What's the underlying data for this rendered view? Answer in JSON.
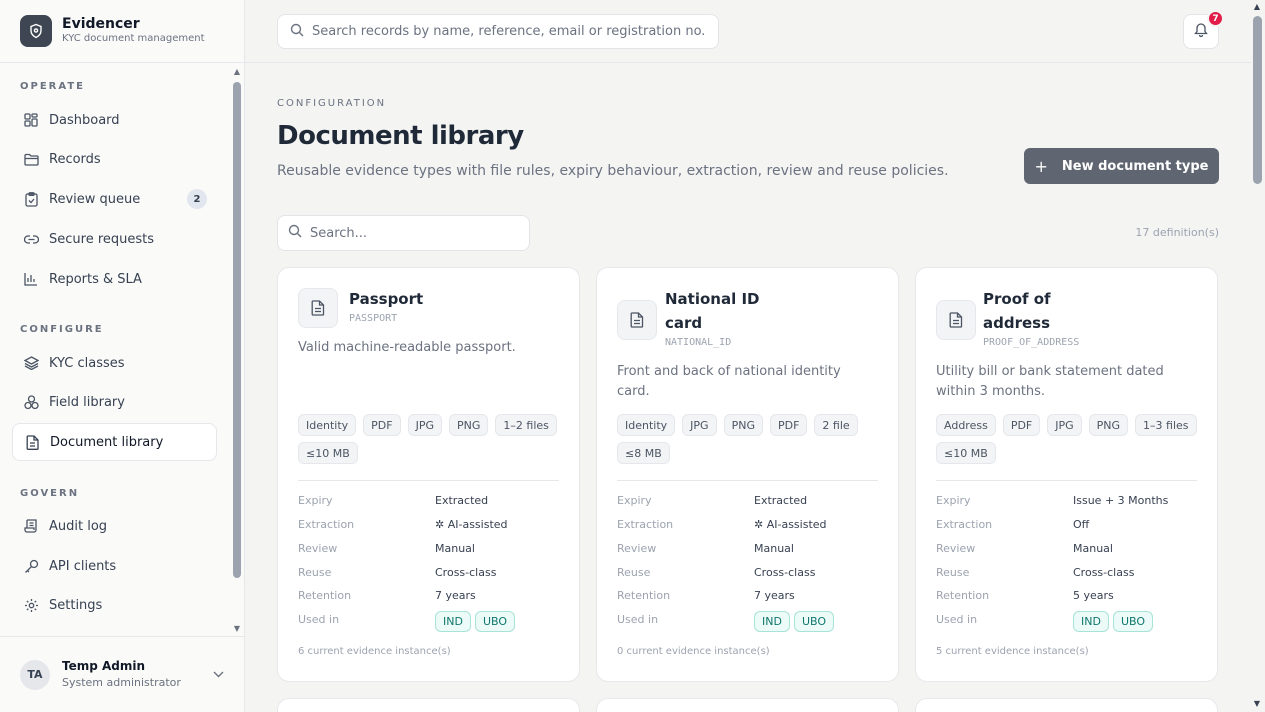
{
  "brand": {
    "name": "Evidencer",
    "subtitle": "KYC document management"
  },
  "sidebar": {
    "sections": [
      "OPERATE",
      "CONFIGURE",
      "GOVERN"
    ],
    "items": [
      {
        "label": "Dashboard",
        "icon": "dashboard-icon"
      },
      {
        "label": "Records",
        "icon": "folder-icon"
      },
      {
        "label": "Review queue",
        "icon": "clipboard-icon",
        "badge": "2"
      },
      {
        "label": "Secure requests",
        "icon": "link-icon"
      },
      {
        "label": "Reports & SLA",
        "icon": "bar-chart-icon"
      },
      {
        "label": "KYC classes",
        "icon": "layers-icon"
      },
      {
        "label": "Field library",
        "icon": "shapes-icon"
      },
      {
        "label": "Document library",
        "icon": "document-icon",
        "active": true
      },
      {
        "label": "Audit log",
        "icon": "scroll-icon"
      },
      {
        "label": "API clients",
        "icon": "key-icon"
      },
      {
        "label": "Settings",
        "icon": "gear-icon"
      }
    ]
  },
  "user": {
    "initials": "TA",
    "name": "Temp Admin",
    "role": "System administrator"
  },
  "topbar": {
    "search_placeholder": "Search records by name, reference, email or registration no.",
    "notifications": "7"
  },
  "page": {
    "eyebrow": "CONFIGURATION",
    "title": "Document library",
    "subtitle": "Reusable evidence types with file rules, expiry behaviour, extraction, review and reuse policies.",
    "new_button": "New document type",
    "filter_placeholder": "Search...",
    "count": "17 definition(s)"
  },
  "labels": {
    "expiry": "Expiry",
    "extraction": "Extraction",
    "review": "Review",
    "reuse": "Reuse",
    "retention": "Retention",
    "used_in": "Used in"
  },
  "cards": [
    {
      "name": "Passport",
      "code": "PASSPORT",
      "description": "Valid machine-readable passport.",
      "chips": [
        "Identity",
        "PDF",
        "JPG",
        "PNG",
        "1–2 files",
        "≤10 MB"
      ],
      "expiry": "Extracted",
      "extraction": "AI-assisted",
      "review": "Manual",
      "reuse": "Cross-class",
      "retention": "7 years",
      "used_in": [
        "IND",
        "UBO"
      ],
      "footer": "6 current evidence instance(s)"
    },
    {
      "name": "National ID card",
      "name_line1": "National ID",
      "name_line2": "card",
      "code": "NATIONAL_ID",
      "description": "Front and back of national identity card.",
      "chips": [
        "Identity",
        "JPG",
        "PNG",
        "PDF",
        "2 file",
        "≤8 MB"
      ],
      "expiry": "Extracted",
      "extraction": "AI-assisted",
      "review": "Manual",
      "reuse": "Cross-class",
      "retention": "7 years",
      "used_in": [
        "IND",
        "UBO"
      ],
      "footer": "0 current evidence instance(s)"
    },
    {
      "name": "Proof of address",
      "name_line1": "Proof of",
      "name_line2": "address",
      "code": "PROOF_OF_ADDRESS",
      "description": "Utility bill or bank statement dated within 3 months.",
      "chips": [
        "Address",
        "PDF",
        "JPG",
        "PNG",
        "1–3 files",
        "≤10 MB"
      ],
      "expiry": "Issue + 3 Months",
      "extraction": "Off",
      "review": "Manual",
      "reuse": "Cross-class",
      "retention": "5 years",
      "used_in": [
        "IND",
        "UBO"
      ],
      "footer": "5 current evidence instance(s)"
    }
  ],
  "colors": {
    "accent_button": "#5f6672",
    "badge": "#e11d48",
    "class_chip": "#0f766e"
  }
}
